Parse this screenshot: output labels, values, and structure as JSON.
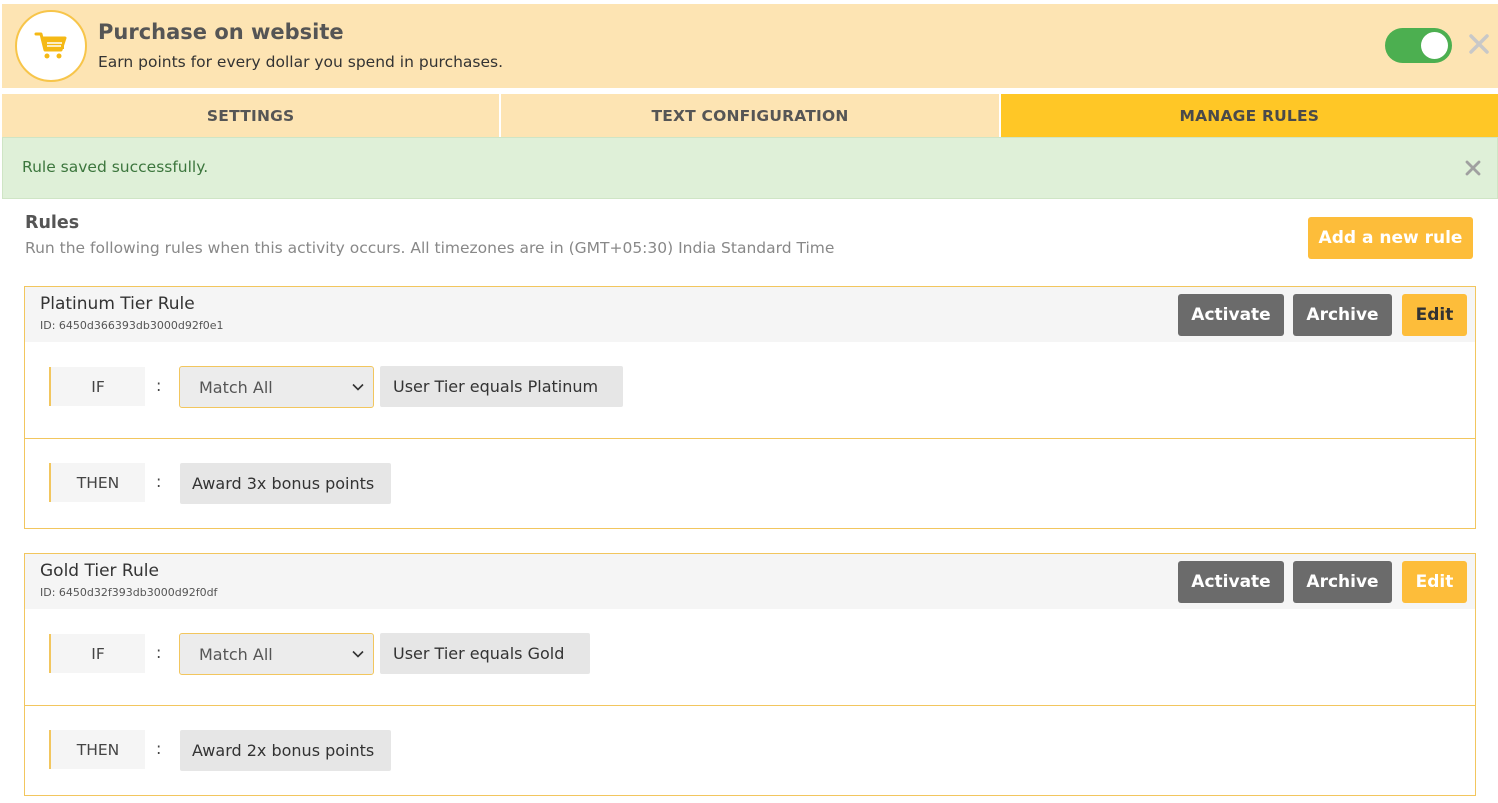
{
  "header": {
    "title": "Purchase on website",
    "subtitle": "Earn points for every dollar you spend in purchases.",
    "icon": "shopping-cart-icon",
    "enabled": true
  },
  "tabs": [
    {
      "label": "SETTINGS",
      "active": false
    },
    {
      "label": "TEXT CONFIGURATION",
      "active": false
    },
    {
      "label": "MANAGE RULES",
      "active": true
    }
  ],
  "alert": {
    "message": "Rule saved successfully."
  },
  "rules_section": {
    "title": "Rules",
    "description": "Run the following rules when this activity occurs. All timezones are in (GMT+05:30) India Standard Time",
    "add_button": "Add a new rule"
  },
  "rules": [
    {
      "name": "Platinum Tier Rule",
      "id_text": "ID: 6450d366393db3000d92f0e1",
      "activate_label": "Activate",
      "archive_label": "Archive",
      "edit_label": "Edit",
      "if_label": "IF",
      "then_label": "THEN",
      "colon": ":",
      "match": "Match All",
      "condition": "User Tier equals Platinum",
      "action": "Award 3x bonus points"
    },
    {
      "name": "Gold Tier Rule",
      "id_text": "ID: 6450d32f393db3000d92f0df",
      "activate_label": "Activate",
      "archive_label": "Archive",
      "edit_label": "Edit",
      "if_label": "IF",
      "then_label": "THEN",
      "colon": ":",
      "match": "Match All",
      "condition": "User Tier equals Gold",
      "action": "Award 2x bonus points"
    }
  ],
  "colors": {
    "header_bg": "#fde4b3",
    "tab_active": "#ffc726",
    "accent": "#fdbd3a",
    "toggle_on": "#4caf50",
    "alert_bg": "#dff0d8",
    "alert_text": "#3c763d",
    "button_dark": "#6b6b6b"
  }
}
